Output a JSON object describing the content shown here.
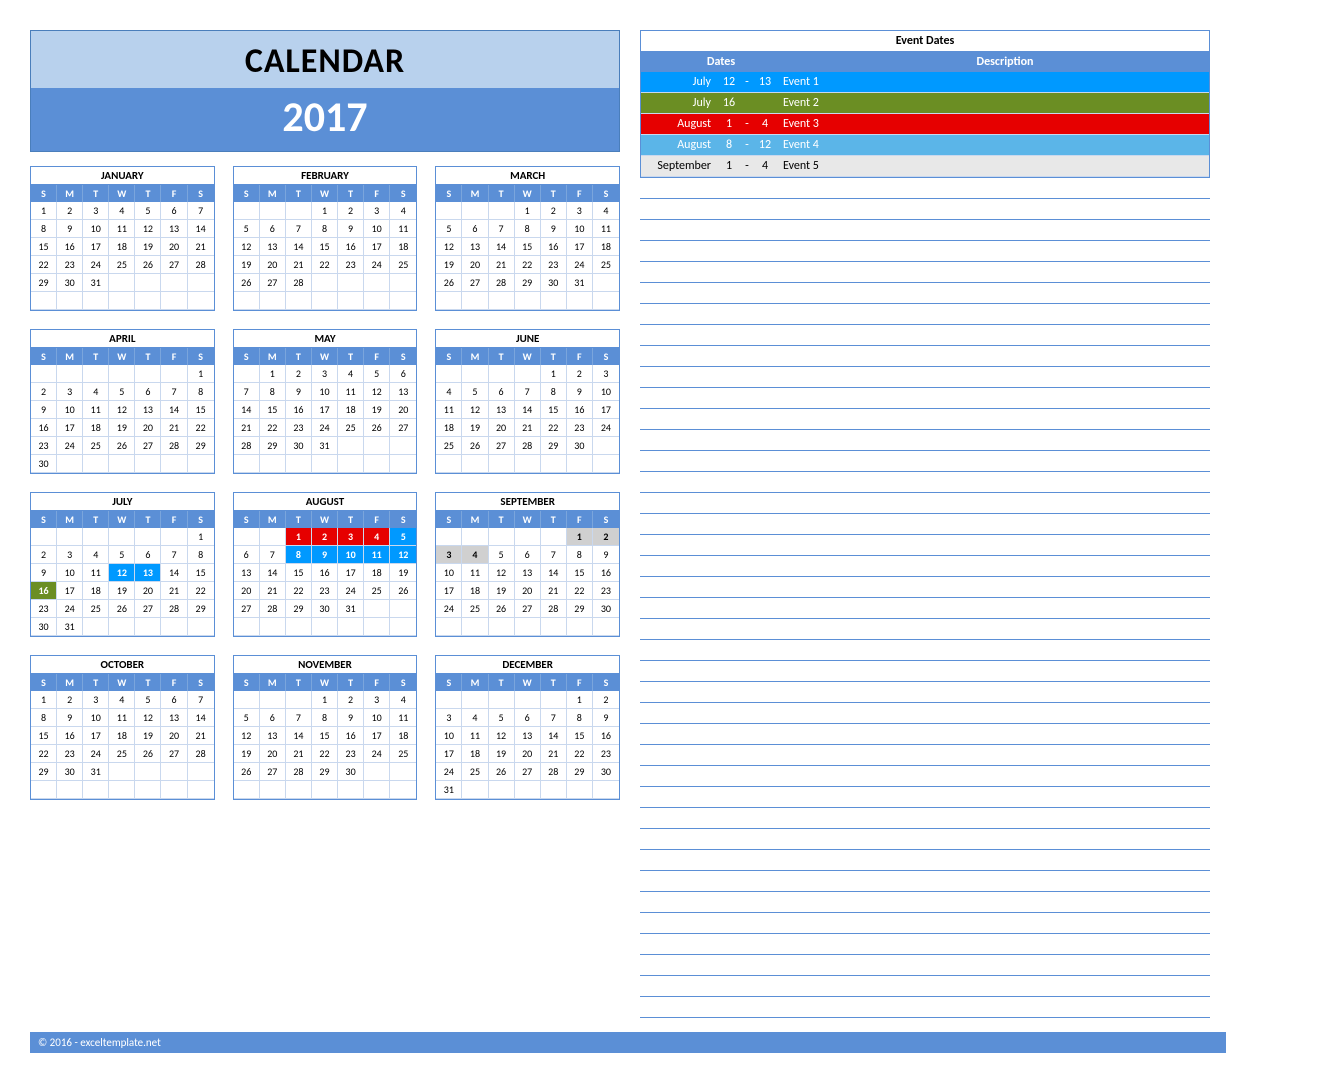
{
  "header": {
    "title": "CALENDAR",
    "year": "2017"
  },
  "dow": [
    "S",
    "M",
    "T",
    "W",
    "T",
    "F",
    "S"
  ],
  "months": [
    {
      "name": "JANUARY",
      "start": 0,
      "days": 31
    },
    {
      "name": "FEBRUARY",
      "start": 3,
      "days": 28
    },
    {
      "name": "MARCH",
      "start": 3,
      "days": 31
    },
    {
      "name": "APRIL",
      "start": 6,
      "days": 30
    },
    {
      "name": "MAY",
      "start": 1,
      "days": 31
    },
    {
      "name": "JUNE",
      "start": 4,
      "days": 30
    },
    {
      "name": "JULY",
      "start": 6,
      "days": 31
    },
    {
      "name": "AUGUST",
      "start": 2,
      "days": 31
    },
    {
      "name": "SEPTEMBER",
      "start": 5,
      "days": 30
    },
    {
      "name": "OCTOBER",
      "start": 0,
      "days": 31
    },
    {
      "name": "NOVEMBER",
      "start": 3,
      "days": 30
    },
    {
      "name": "DECEMBER",
      "start": 5,
      "days": 31
    }
  ],
  "highlights": [
    {
      "month": 6,
      "from": 12,
      "to": 13,
      "class": "hi-blue"
    },
    {
      "month": 6,
      "from": 16,
      "to": 16,
      "class": "hi-olive"
    },
    {
      "month": 7,
      "from": 1,
      "to": 4,
      "class": "hi-red"
    },
    {
      "month": 7,
      "from": 5,
      "to": 5,
      "class": "hi-blue"
    },
    {
      "month": 7,
      "from": 8,
      "to": 12,
      "class": "hi-blue"
    },
    {
      "month": 8,
      "from": 1,
      "to": 4,
      "class": "hi-gray"
    }
  ],
  "events_title": "Event Dates",
  "events_header": {
    "dates": "Dates",
    "desc": "Description"
  },
  "events": [
    {
      "month": "July",
      "d1": "12",
      "sep": "-",
      "d2": "13",
      "desc": "Event 1",
      "class": "ev-blue"
    },
    {
      "month": "July",
      "d1": "16",
      "sep": "",
      "d2": "",
      "desc": "Event 2",
      "class": "ev-olive"
    },
    {
      "month": "August",
      "d1": "1",
      "sep": "-",
      "d2": "4",
      "desc": "Event 3",
      "class": "ev-red"
    },
    {
      "month": "August",
      "d1": "8",
      "sep": "-",
      "d2": "12",
      "desc": "Event 4",
      "class": "ev-lightblue"
    },
    {
      "month": "September",
      "d1": "1",
      "sep": "-",
      "d2": "4",
      "desc": "Event 5",
      "class": "ev-gray"
    }
  ],
  "blank_rows": 40,
  "footer": "© 2016 - exceltemplate.net"
}
